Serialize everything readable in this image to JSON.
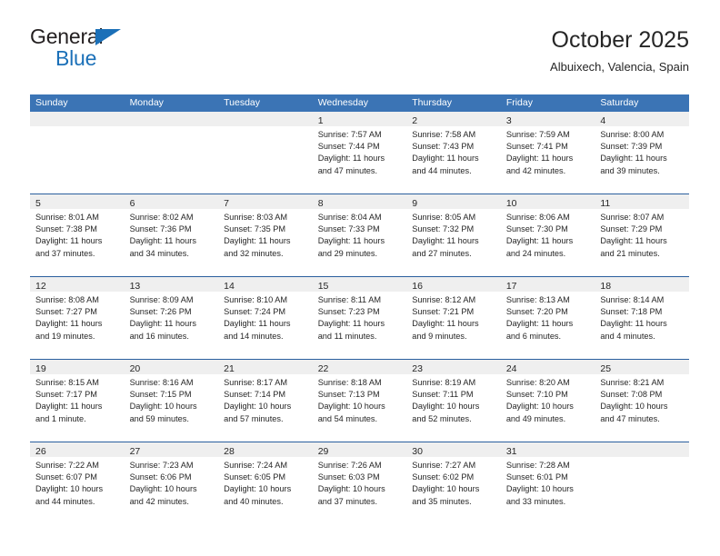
{
  "brand": {
    "line1": "General",
    "line2": "Blue",
    "triangle_color": "#1b70b8",
    "text_color": "#231f20"
  },
  "header": {
    "title": "October 2025",
    "subtitle": "Albuixech, Valencia, Spain"
  },
  "theme": {
    "header_blue": "#3b74b5",
    "rule_blue": "#2a5f9e",
    "day_band_gray": "#efefef",
    "text": "#262626"
  },
  "calendar": {
    "weekdays": [
      "Sunday",
      "Monday",
      "Tuesday",
      "Wednesday",
      "Thursday",
      "Friday",
      "Saturday"
    ],
    "weeks": [
      [
        {
          "day": "",
          "sunrise": "",
          "sunset": "",
          "daylight_line1": "",
          "daylight_line2": ""
        },
        {
          "day": "",
          "sunrise": "",
          "sunset": "",
          "daylight_line1": "",
          "daylight_line2": ""
        },
        {
          "day": "",
          "sunrise": "",
          "sunset": "",
          "daylight_line1": "",
          "daylight_line2": ""
        },
        {
          "day": "1",
          "sunrise": "Sunrise: 7:57 AM",
          "sunset": "Sunset: 7:44 PM",
          "daylight_line1": "Daylight: 11 hours",
          "daylight_line2": "and 47 minutes."
        },
        {
          "day": "2",
          "sunrise": "Sunrise: 7:58 AM",
          "sunset": "Sunset: 7:43 PM",
          "daylight_line1": "Daylight: 11 hours",
          "daylight_line2": "and 44 minutes."
        },
        {
          "day": "3",
          "sunrise": "Sunrise: 7:59 AM",
          "sunset": "Sunset: 7:41 PM",
          "daylight_line1": "Daylight: 11 hours",
          "daylight_line2": "and 42 minutes."
        },
        {
          "day": "4",
          "sunrise": "Sunrise: 8:00 AM",
          "sunset": "Sunset: 7:39 PM",
          "daylight_line1": "Daylight: 11 hours",
          "daylight_line2": "and 39 minutes."
        }
      ],
      [
        {
          "day": "5",
          "sunrise": "Sunrise: 8:01 AM",
          "sunset": "Sunset: 7:38 PM",
          "daylight_line1": "Daylight: 11 hours",
          "daylight_line2": "and 37 minutes."
        },
        {
          "day": "6",
          "sunrise": "Sunrise: 8:02 AM",
          "sunset": "Sunset: 7:36 PM",
          "daylight_line1": "Daylight: 11 hours",
          "daylight_line2": "and 34 minutes."
        },
        {
          "day": "7",
          "sunrise": "Sunrise: 8:03 AM",
          "sunset": "Sunset: 7:35 PM",
          "daylight_line1": "Daylight: 11 hours",
          "daylight_line2": "and 32 minutes."
        },
        {
          "day": "8",
          "sunrise": "Sunrise: 8:04 AM",
          "sunset": "Sunset: 7:33 PM",
          "daylight_line1": "Daylight: 11 hours",
          "daylight_line2": "and 29 minutes."
        },
        {
          "day": "9",
          "sunrise": "Sunrise: 8:05 AM",
          "sunset": "Sunset: 7:32 PM",
          "daylight_line1": "Daylight: 11 hours",
          "daylight_line2": "and 27 minutes."
        },
        {
          "day": "10",
          "sunrise": "Sunrise: 8:06 AM",
          "sunset": "Sunset: 7:30 PM",
          "daylight_line1": "Daylight: 11 hours",
          "daylight_line2": "and 24 minutes."
        },
        {
          "day": "11",
          "sunrise": "Sunrise: 8:07 AM",
          "sunset": "Sunset: 7:29 PM",
          "daylight_line1": "Daylight: 11 hours",
          "daylight_line2": "and 21 minutes."
        }
      ],
      [
        {
          "day": "12",
          "sunrise": "Sunrise: 8:08 AM",
          "sunset": "Sunset: 7:27 PM",
          "daylight_line1": "Daylight: 11 hours",
          "daylight_line2": "and 19 minutes."
        },
        {
          "day": "13",
          "sunrise": "Sunrise: 8:09 AM",
          "sunset": "Sunset: 7:26 PM",
          "daylight_line1": "Daylight: 11 hours",
          "daylight_line2": "and 16 minutes."
        },
        {
          "day": "14",
          "sunrise": "Sunrise: 8:10 AM",
          "sunset": "Sunset: 7:24 PM",
          "daylight_line1": "Daylight: 11 hours",
          "daylight_line2": "and 14 minutes."
        },
        {
          "day": "15",
          "sunrise": "Sunrise: 8:11 AM",
          "sunset": "Sunset: 7:23 PM",
          "daylight_line1": "Daylight: 11 hours",
          "daylight_line2": "and 11 minutes."
        },
        {
          "day": "16",
          "sunrise": "Sunrise: 8:12 AM",
          "sunset": "Sunset: 7:21 PM",
          "daylight_line1": "Daylight: 11 hours",
          "daylight_line2": "and 9 minutes."
        },
        {
          "day": "17",
          "sunrise": "Sunrise: 8:13 AM",
          "sunset": "Sunset: 7:20 PM",
          "daylight_line1": "Daylight: 11 hours",
          "daylight_line2": "and 6 minutes."
        },
        {
          "day": "18",
          "sunrise": "Sunrise: 8:14 AM",
          "sunset": "Sunset: 7:18 PM",
          "daylight_line1": "Daylight: 11 hours",
          "daylight_line2": "and 4 minutes."
        }
      ],
      [
        {
          "day": "19",
          "sunrise": "Sunrise: 8:15 AM",
          "sunset": "Sunset: 7:17 PM",
          "daylight_line1": "Daylight: 11 hours",
          "daylight_line2": "and 1 minute."
        },
        {
          "day": "20",
          "sunrise": "Sunrise: 8:16 AM",
          "sunset": "Sunset: 7:15 PM",
          "daylight_line1": "Daylight: 10 hours",
          "daylight_line2": "and 59 minutes."
        },
        {
          "day": "21",
          "sunrise": "Sunrise: 8:17 AM",
          "sunset": "Sunset: 7:14 PM",
          "daylight_line1": "Daylight: 10 hours",
          "daylight_line2": "and 57 minutes."
        },
        {
          "day": "22",
          "sunrise": "Sunrise: 8:18 AM",
          "sunset": "Sunset: 7:13 PM",
          "daylight_line1": "Daylight: 10 hours",
          "daylight_line2": "and 54 minutes."
        },
        {
          "day": "23",
          "sunrise": "Sunrise: 8:19 AM",
          "sunset": "Sunset: 7:11 PM",
          "daylight_line1": "Daylight: 10 hours",
          "daylight_line2": "and 52 minutes."
        },
        {
          "day": "24",
          "sunrise": "Sunrise: 8:20 AM",
          "sunset": "Sunset: 7:10 PM",
          "daylight_line1": "Daylight: 10 hours",
          "daylight_line2": "and 49 minutes."
        },
        {
          "day": "25",
          "sunrise": "Sunrise: 8:21 AM",
          "sunset": "Sunset: 7:08 PM",
          "daylight_line1": "Daylight: 10 hours",
          "daylight_line2": "and 47 minutes."
        }
      ],
      [
        {
          "day": "26",
          "sunrise": "Sunrise: 7:22 AM",
          "sunset": "Sunset: 6:07 PM",
          "daylight_line1": "Daylight: 10 hours",
          "daylight_line2": "and 44 minutes."
        },
        {
          "day": "27",
          "sunrise": "Sunrise: 7:23 AM",
          "sunset": "Sunset: 6:06 PM",
          "daylight_line1": "Daylight: 10 hours",
          "daylight_line2": "and 42 minutes."
        },
        {
          "day": "28",
          "sunrise": "Sunrise: 7:24 AM",
          "sunset": "Sunset: 6:05 PM",
          "daylight_line1": "Daylight: 10 hours",
          "daylight_line2": "and 40 minutes."
        },
        {
          "day": "29",
          "sunrise": "Sunrise: 7:26 AM",
          "sunset": "Sunset: 6:03 PM",
          "daylight_line1": "Daylight: 10 hours",
          "daylight_line2": "and 37 minutes."
        },
        {
          "day": "30",
          "sunrise": "Sunrise: 7:27 AM",
          "sunset": "Sunset: 6:02 PM",
          "daylight_line1": "Daylight: 10 hours",
          "daylight_line2": "and 35 minutes."
        },
        {
          "day": "31",
          "sunrise": "Sunrise: 7:28 AM",
          "sunset": "Sunset: 6:01 PM",
          "daylight_line1": "Daylight: 10 hours",
          "daylight_line2": "and 33 minutes."
        },
        {
          "day": "",
          "sunrise": "",
          "sunset": "",
          "daylight_line1": "",
          "daylight_line2": ""
        }
      ]
    ]
  }
}
